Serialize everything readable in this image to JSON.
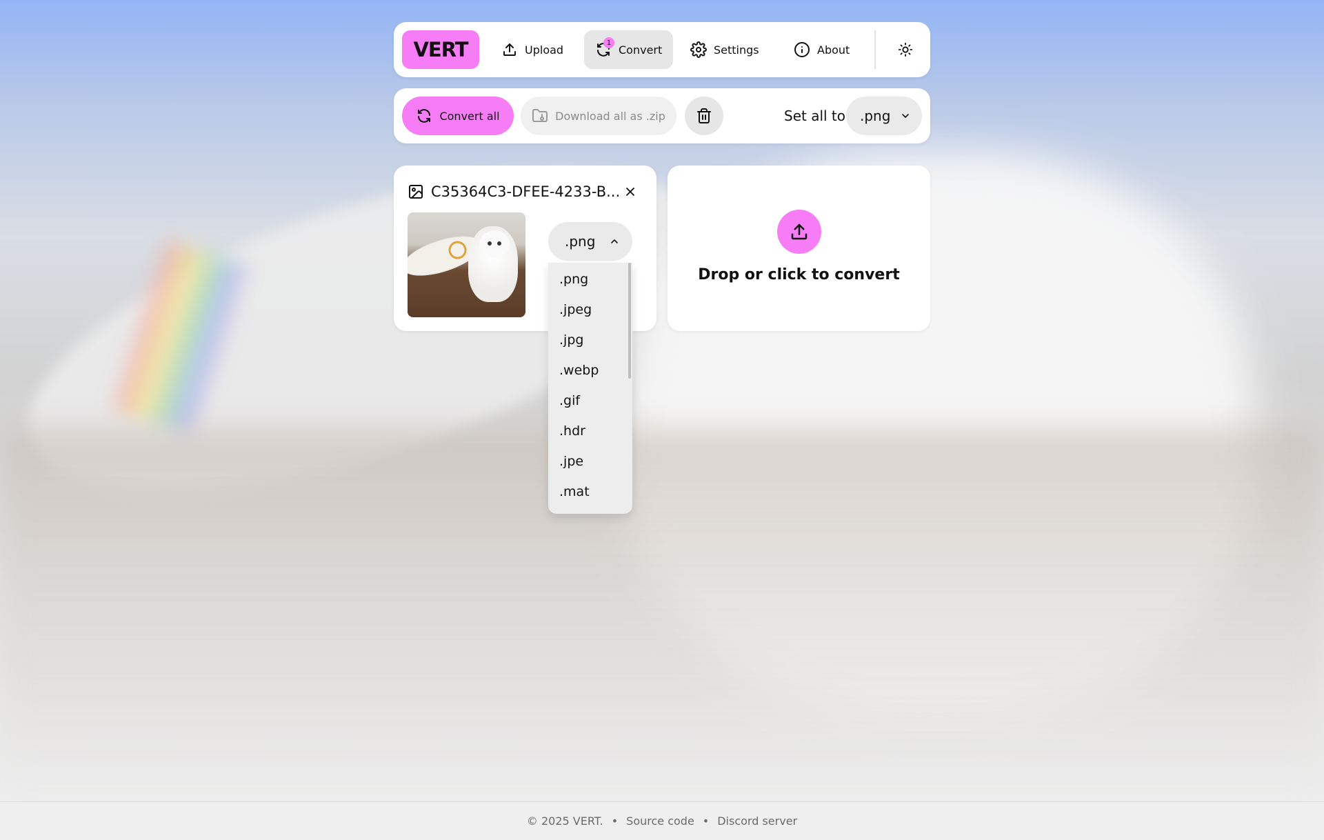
{
  "nav": {
    "logo": "VERT",
    "items": [
      {
        "label": "Upload",
        "icon": "upload-icon"
      },
      {
        "label": "Convert",
        "icon": "convert-icon",
        "badge": "1",
        "active": true
      },
      {
        "label": "Settings",
        "icon": "gear-icon"
      },
      {
        "label": "About",
        "icon": "info-icon"
      }
    ],
    "theme_icon": "sun-icon"
  },
  "toolbar": {
    "convert_all_label": "Convert all",
    "download_all_label": "Download all as .zip",
    "set_all_label": "Set all to",
    "set_all_value": ".png"
  },
  "file": {
    "name": "C35364C3-DFEE-4233-B...",
    "format_value": ".png",
    "format_options": [
      ".png",
      ".jpeg",
      ".jpg",
      ".webp",
      ".gif",
      ".hdr",
      ".jpe",
      ".mat"
    ]
  },
  "dropzone": {
    "text": "Drop or click to convert"
  },
  "footer": {
    "copyright": "© 2025 VERT.",
    "source_link": "Source code",
    "discord_link": "Discord server"
  },
  "colors": {
    "accent": "#f67df6",
    "muted_bg": "#eaeaea"
  }
}
